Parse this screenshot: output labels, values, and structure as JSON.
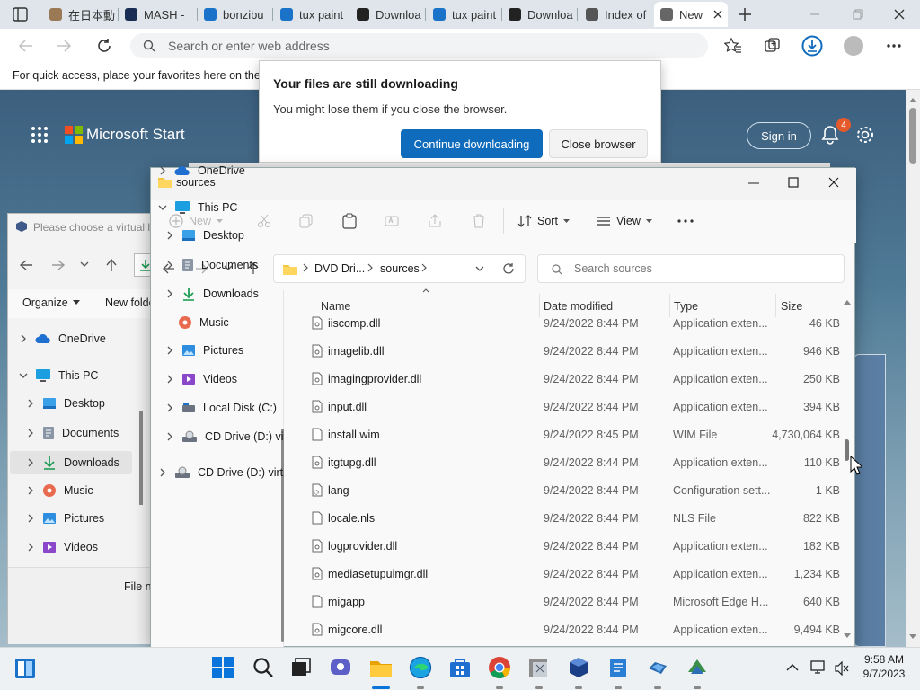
{
  "browser": {
    "tabs": [
      {
        "label": "在日本動"
      },
      {
        "label": "MASH -"
      },
      {
        "label": "bonzibu"
      },
      {
        "label": "tux paint"
      },
      {
        "label": "Downloa"
      },
      {
        "label": "tux paint"
      },
      {
        "label": "Downloa"
      },
      {
        "label": "Index of"
      },
      {
        "label": "New",
        "active": true
      }
    ],
    "address_placeholder": "Search or enter web address",
    "favorites_hint": "For quick access, place your favorites here on the f",
    "download_badge_color": "#0f6cbd"
  },
  "start_page": {
    "brand": "Microsoft Start",
    "sign_in": "Sign in",
    "notification_count": "4"
  },
  "download_popup": {
    "title": "Your files are still downloading",
    "message": "You might lose them if you close the browser.",
    "continue_label": "Continue downloading",
    "close_label": "Close browser"
  },
  "back_window": {
    "vm_prompt": "Please choose a virtual h",
    "organize": "Organize",
    "new_folder": "New folde",
    "file_name_label": "File n",
    "nav": [
      {
        "label": "OneDrive",
        "icon": "cloud-icon"
      },
      {
        "label": "This PC",
        "icon": "pc-icon"
      },
      {
        "label": "Desktop",
        "icon": "desktop-icon"
      },
      {
        "label": "Documents",
        "icon": "documents-icon"
      },
      {
        "label": "Downloads",
        "icon": "downloads-icon",
        "selected": true
      },
      {
        "label": "Music",
        "icon": "music-icon"
      },
      {
        "label": "Pictures",
        "icon": "pictures-icon"
      },
      {
        "label": "Videos",
        "icon": "videos-icon"
      }
    ]
  },
  "explorer": {
    "title": "sources",
    "commands": {
      "new": "New",
      "sort": "Sort",
      "view": "View"
    },
    "breadcrumb": [
      "DVD Dri...",
      "sources"
    ],
    "search_placeholder": "Search sources",
    "nav": [
      {
        "label": "OneDrive",
        "icon": "cloud-icon"
      },
      {
        "label": "This PC",
        "icon": "pc-icon"
      },
      {
        "label": "Desktop",
        "icon": "desktop-icon"
      },
      {
        "label": "Documents",
        "icon": "documents-icon"
      },
      {
        "label": "Downloads",
        "icon": "downloads-icon"
      },
      {
        "label": "Music",
        "icon": "music-icon"
      },
      {
        "label": "Pictures",
        "icon": "pictures-icon"
      },
      {
        "label": "Videos",
        "icon": "videos-icon"
      },
      {
        "label": "Local Disk (C:)",
        "icon": "drive-icon"
      },
      {
        "label": "CD Drive (D:) vi",
        "icon": "cd-drive-icon"
      },
      {
        "label": "CD Drive (D:) virt",
        "icon": "cd-drive-icon"
      }
    ],
    "columns": {
      "name": "Name",
      "date": "Date modified",
      "type": "Type",
      "size": "Size"
    },
    "files": [
      {
        "name": "iiscomp.dll",
        "date": "9/24/2022 8:44 PM",
        "type": "Application exten...",
        "size": "46 KB",
        "icon": "dll-file-icon"
      },
      {
        "name": "imagelib.dll",
        "date": "9/24/2022 8:44 PM",
        "type": "Application exten...",
        "size": "946 KB",
        "icon": "dll-file-icon"
      },
      {
        "name": "imagingprovider.dll",
        "date": "9/24/2022 8:44 PM",
        "type": "Application exten...",
        "size": "250 KB",
        "icon": "dll-file-icon"
      },
      {
        "name": "input.dll",
        "date": "9/24/2022 8:44 PM",
        "type": "Application exten...",
        "size": "394 KB",
        "icon": "dll-file-icon"
      },
      {
        "name": "install.wim",
        "date": "9/24/2022 8:45 PM",
        "type": "WIM File",
        "size": "4,730,064 KB",
        "icon": "file-icon"
      },
      {
        "name": "itgtupg.dll",
        "date": "9/24/2022 8:44 PM",
        "type": "Application exten...",
        "size": "110 KB",
        "icon": "dll-file-icon"
      },
      {
        "name": "lang",
        "date": "9/24/2022 8:44 PM",
        "type": "Configuration sett...",
        "size": "1 KB",
        "icon": "config-file-icon"
      },
      {
        "name": "locale.nls",
        "date": "9/24/2022 8:44 PM",
        "type": "NLS File",
        "size": "822 KB",
        "icon": "file-icon"
      },
      {
        "name": "logprovider.dll",
        "date": "9/24/2022 8:44 PM",
        "type": "Application exten...",
        "size": "182 KB",
        "icon": "dll-file-icon"
      },
      {
        "name": "mediasetupuimgr.dll",
        "date": "9/24/2022 8:44 PM",
        "type": "Application exten...",
        "size": "1,234 KB",
        "icon": "dll-file-icon"
      },
      {
        "name": "migapp",
        "date": "9/24/2022 8:44 PM",
        "type": "Microsoft Edge H...",
        "size": "640 KB",
        "icon": "file-icon"
      },
      {
        "name": "migcore.dll",
        "date": "9/24/2022 8:44 PM",
        "type": "Application exten...",
        "size": "9,494 KB",
        "icon": "dll-file-icon"
      }
    ]
  },
  "taskbar": {
    "time": "9:58 AM",
    "date": "9/7/2023",
    "apps": [
      "start-icon",
      "search-icon",
      "task-view-icon",
      "chat-icon",
      "file-explorer-icon",
      "edge-icon",
      "store-icon",
      "chrome-icon",
      "app-icon",
      "virtualbox-icon",
      "notepad-icon",
      "app-icon",
      "app-icon"
    ]
  }
}
